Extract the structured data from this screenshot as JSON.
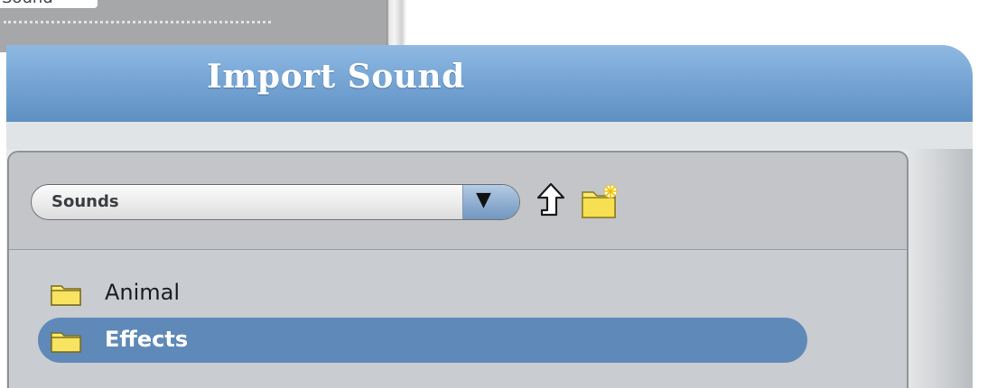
{
  "background": {
    "tab_label": "Sound"
  },
  "dialog": {
    "title": "Import Sound",
    "location": {
      "selected": "Sounds"
    },
    "items": [
      {
        "label": "Animal",
        "icon": "folder-icon",
        "selected": false
      },
      {
        "label": "Effects",
        "icon": "folder-icon",
        "selected": true
      }
    ]
  },
  "colors": {
    "title_bar": "#77a6d5",
    "selection": "#5f89b8",
    "folder": "#fbeb6e"
  }
}
